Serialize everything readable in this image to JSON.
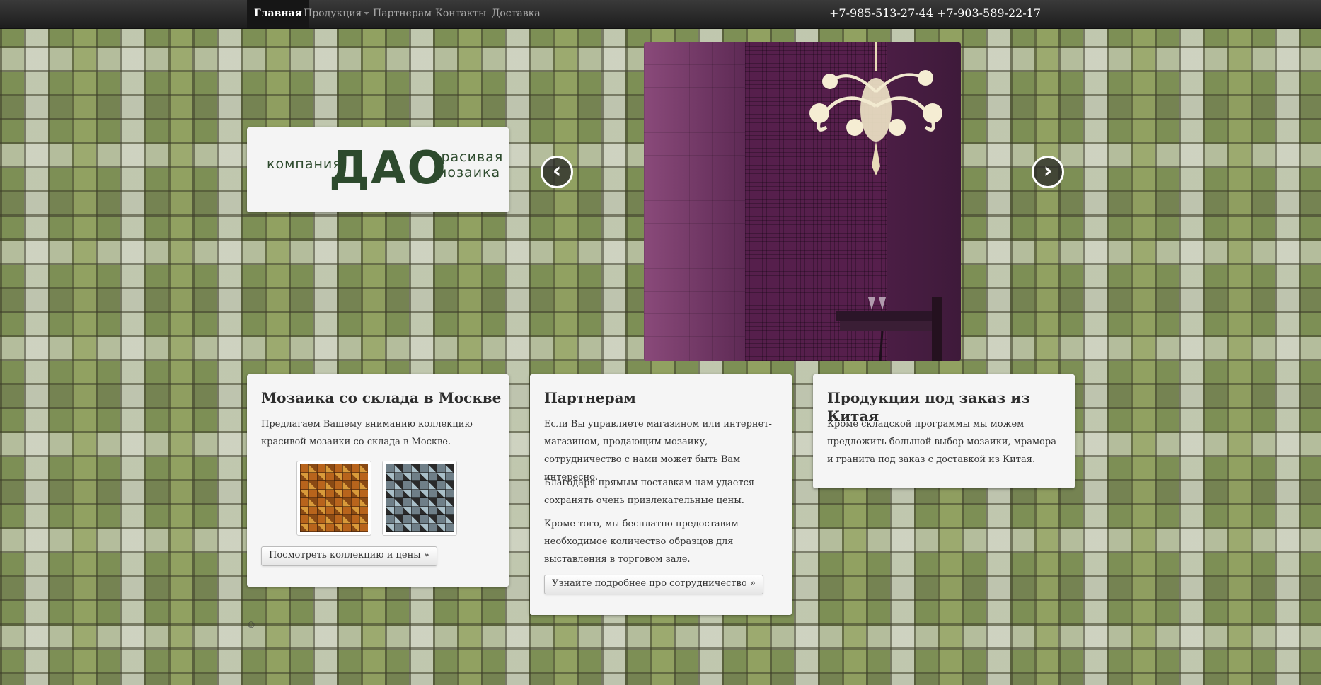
{
  "nav": {
    "items": [
      {
        "label": "Главная",
        "active": true
      },
      {
        "label": "Продукция",
        "dropdown": true
      },
      {
        "label": "Партнерам"
      },
      {
        "label": "Контакты"
      },
      {
        "label": "Доставка"
      }
    ],
    "phones": "+7-985-513-27-44 +7-903-589-22-17"
  },
  "logo": {
    "left_text_1": "компания",
    "big_text": "ДАО",
    "right_text_1": "красивая",
    "right_text_2": "мозаика"
  },
  "slider": {
    "prev_icon": "chevron-left-icon",
    "next_icon": "chevron-right-icon"
  },
  "cards": [
    {
      "title": "Мозаика со склада в Москве",
      "paragraphs": [
        "Предлагаем Вашему вниманию коллекцию красивой мозаики со склада в Москве."
      ],
      "button": "Посмотреть коллекцию и цены »"
    },
    {
      "title": "Партнерам",
      "paragraphs": [
        "Если Вы управляете магазином или интернет-магазином, продающим мозаику, сотрудничество с нами может быть Вам интересно.",
        "Благодаря прямым поставкам нам удается сохранять очень привлекательные цены.",
        "Кроме того, мы бесплатно предоставим необходимое количество образцов для выставления в торговом зале."
      ],
      "button": "Узнайте подробнее про сотрудничество »"
    },
    {
      "title": "Продукция под заказ из Китая",
      "paragraphs": [
        "Кроме складской программы мы можем предложить большой выбор мозаики, мрамора и гранита под заказ с доставкой из Китая."
      ]
    }
  ],
  "footer": {
    "copyright": "©"
  },
  "colors": {
    "navbar": "#1d1d1d",
    "logo_green": "#2d4a2d",
    "card_bg": "#f5f5f5"
  }
}
